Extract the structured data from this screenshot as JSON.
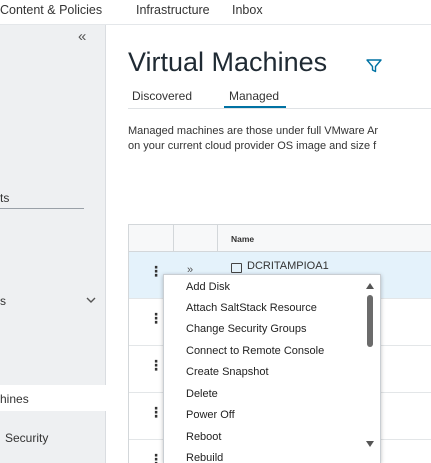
{
  "topnav": {
    "items": [
      "Content & Policies",
      "Infrastructure",
      "Inbox"
    ]
  },
  "sidebar": {
    "collapse_glyph": "«",
    "items": [
      "ts",
      "s",
      "hines",
      "Security"
    ]
  },
  "main": {
    "title": "Virtual Machines",
    "tabs": [
      "Discovered",
      "Managed"
    ],
    "active_tab": "Managed",
    "description": [
      "Managed machines are those under full VMware Ar",
      "on your current cloud provider OS image and size f"
    ]
  },
  "grid": {
    "columns": [
      "Name"
    ],
    "rows": [
      {
        "name": "DCRITAMPIOA1",
        "selected": true
      },
      {
        "name": "",
        "selected": false
      },
      {
        "name": "",
        "selected": false
      },
      {
        "name": "",
        "selected": false
      },
      {
        "name": "",
        "selected": false
      }
    ]
  },
  "context_menu": {
    "items": [
      "Add Disk",
      "Attach SaltStack Resource",
      "Change Security Groups",
      "Connect to Remote Console",
      "Create Snapshot",
      "Delete",
      "Power Off",
      "Reboot",
      "Rebuild"
    ]
  },
  "colors": {
    "accent": "#0072a3",
    "sidebar_bg": "#eef0f2",
    "selected_row": "#e4f2fb"
  },
  "icons": {
    "collapse": "double-chevron-left-icon",
    "filter": "filter-icon",
    "row_actions": "vertical-ellipsis-icon",
    "expand": "double-chevron-right-icon",
    "vm": "vm-icon"
  }
}
